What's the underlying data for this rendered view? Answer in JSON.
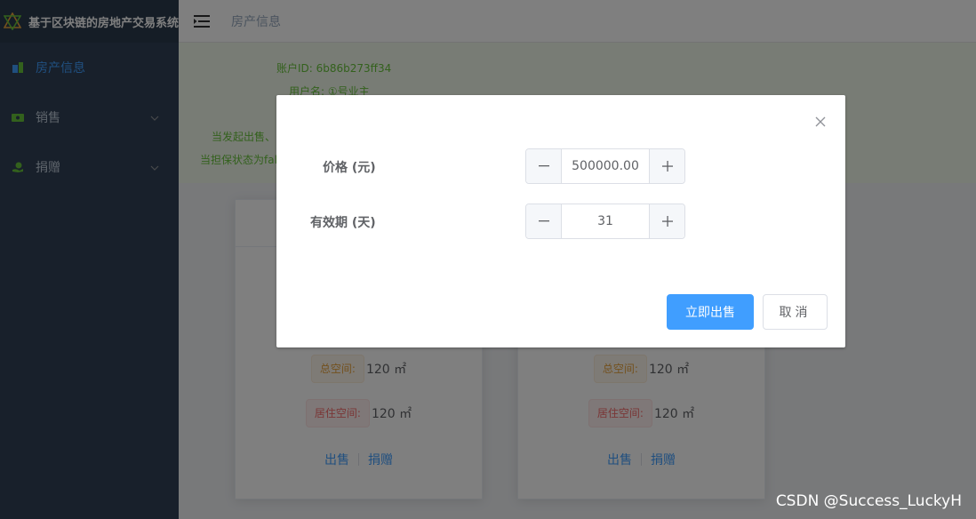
{
  "app": {
    "title": "基于区块链的房地产交易系统"
  },
  "sidebar": {
    "items": [
      {
        "label": "房产信息",
        "icon": "house-icon",
        "active": true
      },
      {
        "label": "销售",
        "icon": "cash-icon",
        "active": false
      },
      {
        "label": "捐赠",
        "icon": "donate-icon",
        "active": false
      }
    ]
  },
  "topbar": {
    "breadcrumb": "房产信息"
  },
  "banner": {
    "account_id": "账户ID: 6b86b273ff34",
    "username": "用户名: ①号业主",
    "line3": "当发起出售、",
    "line4": "当担保状态为fal"
  },
  "cards": [
    {
      "total_space_label": "总空间:",
      "total_space_value": "120 ㎡",
      "living_space_label": "居住空间:",
      "living_space_value": "120 ㎡",
      "sell_label": "出售",
      "donate_label": "捐赠"
    },
    {
      "total_space_label": "总空间:",
      "total_space_value": "120 ㎡",
      "living_space_label": "居住空间:",
      "living_space_value": "120 ㎡",
      "sell_label": "出售",
      "donate_label": "捐赠"
    }
  ],
  "dialog": {
    "price_label": "价格 (元)",
    "price_value": "500000.00",
    "period_label": "有效期 (天)",
    "period_value": "31",
    "confirm_label": "立即出售",
    "cancel_label": "取消"
  },
  "watermark": "CSDN @Success_LuckyH",
  "colors": {
    "primary": "#409eff",
    "sidebar_bg": "#304156",
    "banner_bg": "#f0f9eb",
    "banner_text": "#67c23a",
    "warning": "#e6a23c",
    "danger": "#f56c6c"
  }
}
